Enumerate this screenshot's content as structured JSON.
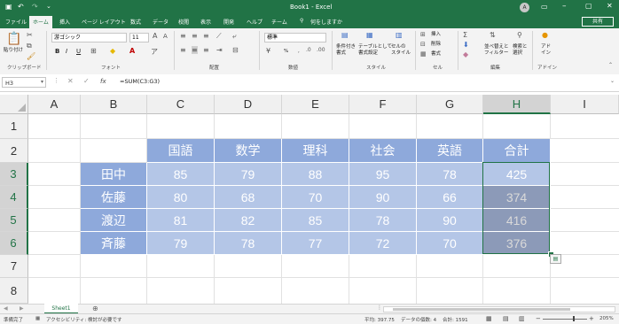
{
  "title_bar": {
    "title": "Book1 - Excel",
    "user_initials": "A"
  },
  "tabs": [
    "ファイル",
    "ホーム",
    "挿入",
    "ページ レイアウト",
    "数式",
    "データ",
    "校閲",
    "表示",
    "開発",
    "ヘルプ",
    "チーム"
  ],
  "tell_me": "何をしますか",
  "share_label": "共有",
  "ribbon": {
    "clipboard": {
      "paste": "貼り付け",
      "label": "クリップボード"
    },
    "font": {
      "name": "游ゴシック",
      "size": "11",
      "label": "フォント",
      "bold": "B",
      "italic": "I",
      "underline": "U"
    },
    "alignment": {
      "label": "配置"
    },
    "number": {
      "format": "標準",
      "label": "数値",
      "percent": "%",
      "comma": ","
    },
    "styles": {
      "conditional": "条件付き\n書式",
      "table": "テーブルとして\n書式設定",
      "cell": "セルの\nスタイル",
      "label": "スタイル"
    },
    "cells": {
      "insert": "挿入",
      "delete": "削除",
      "format": "書式",
      "label": "セル"
    },
    "editing": {
      "sort": "並べ替えと\nフィルター",
      "find": "検索と\n選択",
      "label": "編集"
    },
    "addins": {
      "addin": "アド\nイン",
      "label": "アドイン"
    }
  },
  "formula_bar": {
    "name_box": "H3",
    "fx": "fx",
    "formula": "=SUM(C3:G3)"
  },
  "columns": [
    "A",
    "B",
    "C",
    "D",
    "E",
    "F",
    "G",
    "H",
    "I"
  ],
  "selected_column": "H",
  "rows": [
    "1",
    "2",
    "3",
    "4",
    "5",
    "6",
    "7",
    "8"
  ],
  "selected_rows": [
    "3",
    "4",
    "5",
    "6"
  ],
  "table": {
    "headers": [
      "国語",
      "数学",
      "理科",
      "社会",
      "英語",
      "合計"
    ],
    "students": [
      {
        "name": "田中",
        "scores": [
          "85",
          "79",
          "88",
          "95",
          "78"
        ],
        "total": "425"
      },
      {
        "name": "佐藤",
        "scores": [
          "80",
          "68",
          "70",
          "90",
          "66"
        ],
        "total": "374"
      },
      {
        "name": "渡辺",
        "scores": [
          "81",
          "82",
          "85",
          "78",
          "90"
        ],
        "total": "416"
      },
      {
        "name": "斉藤",
        "scores": [
          "79",
          "78",
          "77",
          "72",
          "70"
        ],
        "total": "376"
      }
    ]
  },
  "colors": {
    "excel_green": "#217346",
    "header_blue": "#8ea9db",
    "name_blue": "#8ea9db",
    "data_blue": "#b4c6e7",
    "total_selected": "#8c9ab8"
  },
  "sheet_tab": "Sheet1",
  "status": {
    "ready": "準備完了",
    "accessibility": "アクセシビリティ: 検討が必要です",
    "average": "平均: 397.75",
    "count": "データの個数: 4",
    "sum": "合計: 1591",
    "zoom": "205%"
  }
}
